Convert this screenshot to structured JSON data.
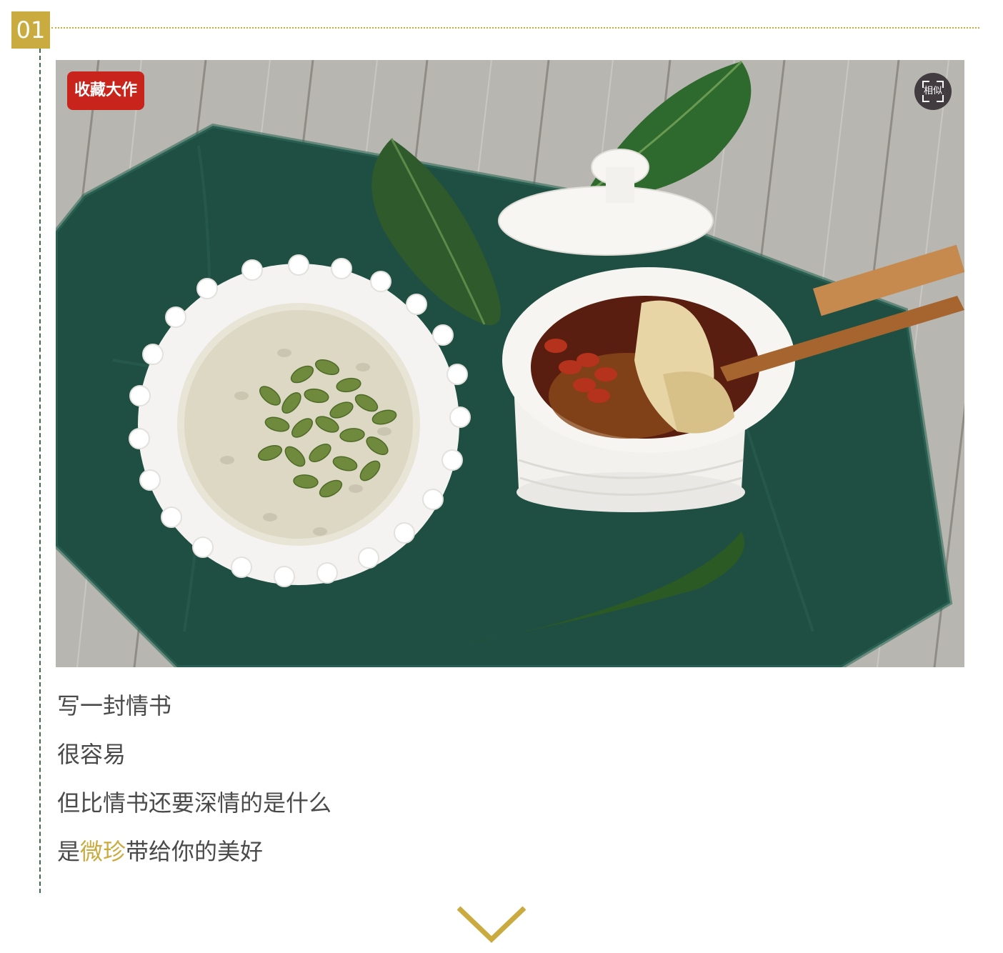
{
  "section": {
    "number": "01"
  },
  "photo": {
    "badge": "收藏大作",
    "similar_button": "相似"
  },
  "poem": {
    "line1": "写一封情书",
    "line2": "很容易",
    "line3": "但比情书还要深情的是什么",
    "line4_before": "是",
    "line4_highlight": "微珍",
    "line4_after": "带给你的美好"
  },
  "colors": {
    "accent_gold": "#c9ab3f",
    "badge_red": "#c8241c",
    "side_rule_green": "#3f6b4a",
    "body_text": "#4a4a4a"
  },
  "icons": {
    "similar": "scan-frame-icon",
    "down": "chevron-down-icon"
  }
}
